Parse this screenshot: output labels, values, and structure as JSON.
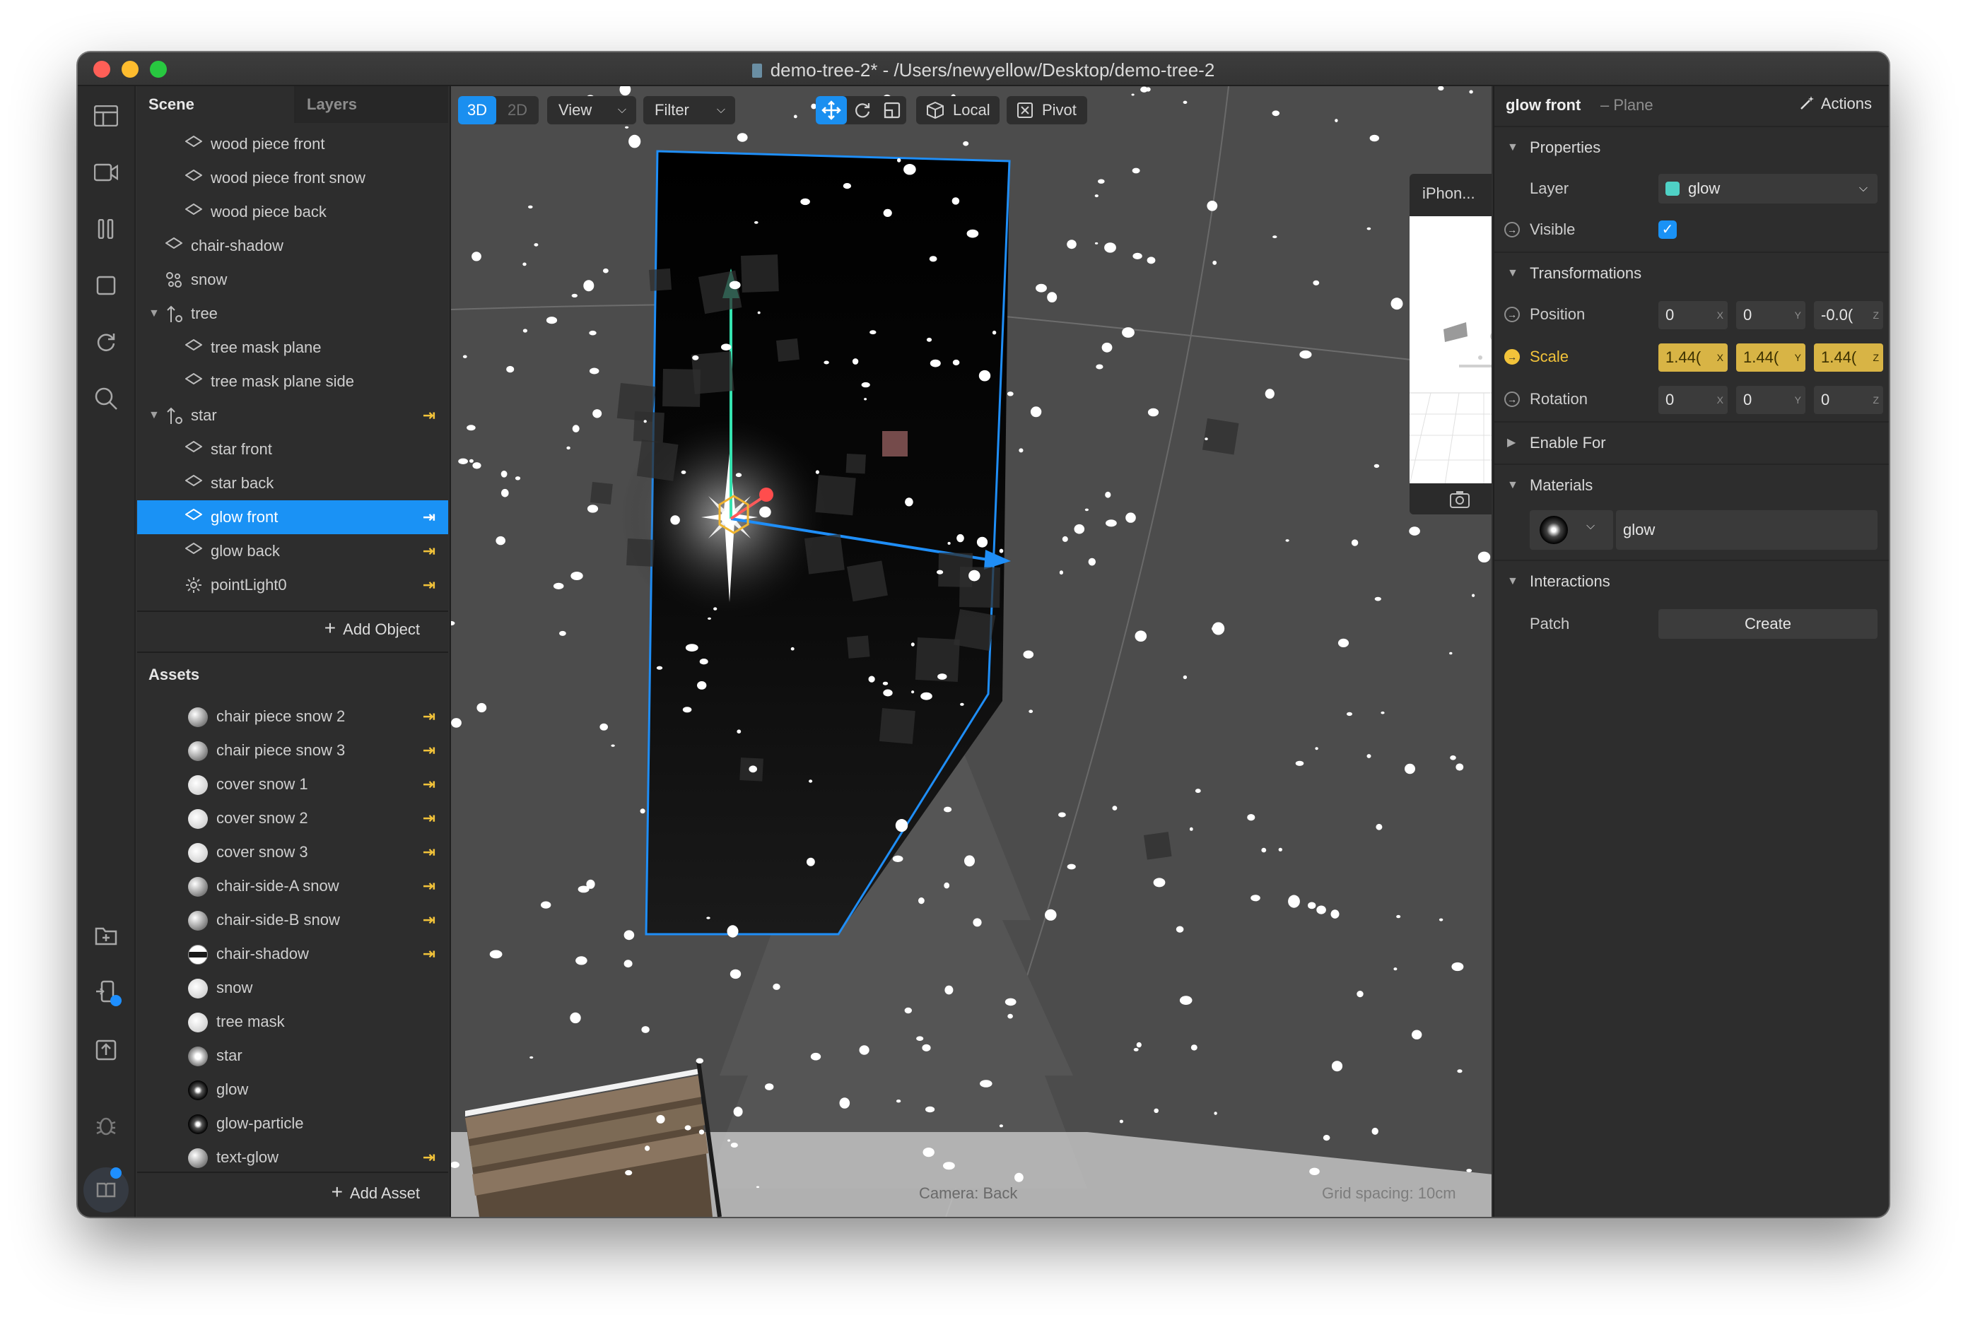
{
  "window": {
    "title": "demo-tree-2* - /Users/newyellow/Desktop/demo-tree-2"
  },
  "rail": {
    "icons": [
      "layout-icon",
      "video-icon",
      "pause-icon",
      "square-icon",
      "refresh-icon",
      "search-icon",
      "new-folder-icon",
      "device-icon",
      "export-icon",
      "bug-icon",
      "book-icon"
    ]
  },
  "scene": {
    "tabs": [
      "Scene",
      "Layers"
    ],
    "items": [
      {
        "label": "wood piece front",
        "icon": "plane-icon",
        "depth": 3,
        "linked": false
      },
      {
        "label": "wood piece front snow",
        "icon": "plane-icon",
        "depth": 3,
        "linked": false
      },
      {
        "label": "wood piece back",
        "icon": "plane-icon",
        "depth": 3,
        "linked": false
      },
      {
        "label": "chair-shadow",
        "icon": "plane-icon",
        "depth": 2,
        "linked": false
      },
      {
        "label": "snow",
        "icon": "particles-icon",
        "depth": 2,
        "linked": false
      },
      {
        "label": "tree",
        "icon": "null-object-icon",
        "depth": 2,
        "linked": false,
        "expanded": true
      },
      {
        "label": "tree mask plane",
        "icon": "plane-icon",
        "depth": 3,
        "linked": false
      },
      {
        "label": "tree mask plane side",
        "icon": "plane-icon",
        "depth": 3,
        "linked": false
      },
      {
        "label": "star",
        "icon": "null-object-icon",
        "depth": 2,
        "linked": true,
        "expanded": true
      },
      {
        "label": "star front",
        "icon": "plane-icon",
        "depth": 3,
        "linked": false
      },
      {
        "label": "star back",
        "icon": "plane-icon",
        "depth": 3,
        "linked": false
      },
      {
        "label": "glow front",
        "icon": "plane-icon",
        "depth": 3,
        "linked": true,
        "selected": true
      },
      {
        "label": "glow back",
        "icon": "plane-icon",
        "depth": 3,
        "linked": true
      },
      {
        "label": "pointLight0",
        "icon": "light-icon",
        "depth": 3,
        "linked": true
      }
    ],
    "add_label": "Add Object"
  },
  "assets": {
    "title": "Assets",
    "items": [
      {
        "label": "chair piece snow 2",
        "swatch": "metal",
        "linked": true
      },
      {
        "label": "chair piece snow 3",
        "swatch": "metal",
        "linked": true
      },
      {
        "label": "cover snow 1",
        "swatch": "white",
        "linked": true
      },
      {
        "label": "cover snow 2",
        "swatch": "white",
        "linked": true
      },
      {
        "label": "cover snow 3",
        "swatch": "white",
        "linked": true
      },
      {
        "label": "chair-side-A snow",
        "swatch": "metal",
        "linked": true
      },
      {
        "label": "chair-side-B snow",
        "swatch": "metal",
        "linked": true
      },
      {
        "label": "chair-shadow",
        "swatch": "stripe",
        "linked": true
      },
      {
        "label": "snow",
        "swatch": "white",
        "linked": false
      },
      {
        "label": "tree mask",
        "swatch": "white",
        "linked": false
      },
      {
        "label": "star",
        "swatch": "star",
        "linked": false
      },
      {
        "label": "glow",
        "swatch": "dark",
        "linked": false
      },
      {
        "label": "glow-particle",
        "swatch": "dark",
        "linked": false
      },
      {
        "label": "text-glow",
        "swatch": "metal",
        "linked": true
      }
    ],
    "add_label": "Add Asset"
  },
  "toolbar": {
    "mode_3d": "3D",
    "mode_2d": "2D",
    "view": "View",
    "filter": "Filter",
    "local": "Local",
    "pivot": "Pivot"
  },
  "viewport": {
    "camera_label": "Camera: Back",
    "grid_label": "Grid spacing: 10cm",
    "preview_device": "iPhon..."
  },
  "properties": {
    "object_name": "glow front",
    "object_type": "– Plane",
    "actions_label": "Actions",
    "sections": {
      "properties": "Properties",
      "transformations": "Transformations",
      "enable_for": "Enable For",
      "materials": "Materials",
      "interactions": "Interactions"
    },
    "layer": {
      "label": "Layer",
      "value": "glow",
      "color": "#4fd1c5"
    },
    "visible": {
      "label": "Visible",
      "checked": true
    },
    "position": {
      "label": "Position",
      "x": "0",
      "y": "0",
      "z": "-0.0("
    },
    "scale": {
      "label": "Scale",
      "x": "1.44(",
      "y": "1.44(",
      "z": "1.44("
    },
    "rotation": {
      "label": "Rotation",
      "x": "0",
      "y": "0",
      "z": "0"
    },
    "material": {
      "value": "glow"
    },
    "patch": {
      "label": "Patch",
      "button": "Create"
    }
  },
  "colors": {
    "accent": "#1a92f5",
    "highlight": "#f2c33a",
    "scale_field": "#d8b445"
  }
}
